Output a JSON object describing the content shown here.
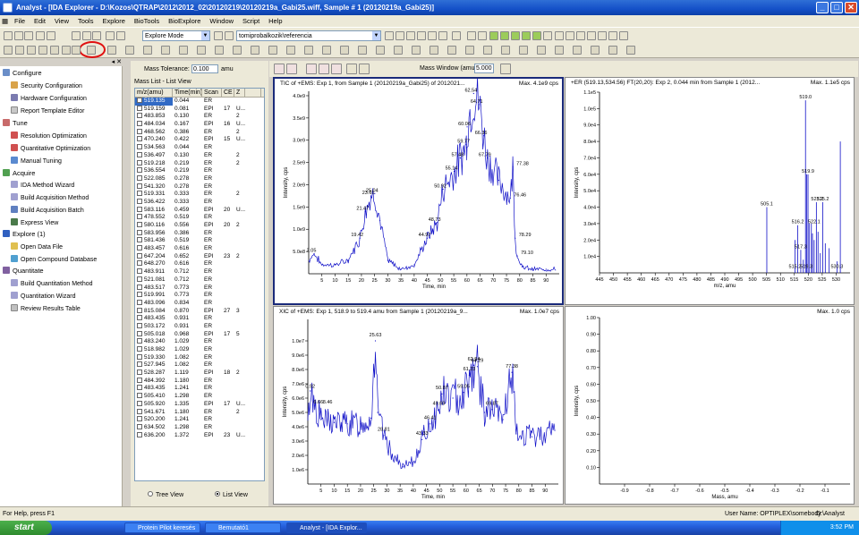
{
  "window": {
    "title": "Analyst - [IDA Explorer - D:\\Kozos\\QTRAP\\2012\\2012_02\\20120219\\20120219a_Gabi25.wiff, Sample # 1 (20120219a_Gabi25)]"
  },
  "menu": [
    "File",
    "Edit",
    "View",
    "Tools",
    "Explore",
    "BioTools",
    "BioExplore",
    "Window",
    "Script",
    "Help"
  ],
  "toolbar": {
    "mode": "Explore Mode",
    "project": "tomiprobalkozik\\referencia"
  },
  "nav": {
    "configure": {
      "label": "Configure",
      "items": [
        "Security Configuration",
        "Hardware Configuration",
        "Report Template Editor"
      ]
    },
    "tune": {
      "label": "Tune",
      "items": [
        "Resolution Optimization",
        "Quantitative Optimization",
        "Manual Tuning"
      ]
    },
    "acquire": {
      "label": "Acquire",
      "items": [
        "IDA Method Wizard",
        "Build Acquisition Method",
        "Build Acquisition Batch",
        "Express View"
      ]
    },
    "explore": {
      "label": "Explore  (1)",
      "items": [
        "Open Data File",
        "Open Compound Database"
      ]
    },
    "quantitate": {
      "label": "Quantitate",
      "items": [
        "Build Quantitation Method",
        "Quantitation Wizard",
        "Review Results Table"
      ]
    }
  },
  "mass": {
    "tolerance_label": "Mass Tolerance:",
    "tolerance": "0.100",
    "unit": "amu",
    "list_title": "Mass List - List View",
    "window_label": "Mass Window (amu):",
    "window": "5.000",
    "headers": [
      "m/z(amu)",
      "Time(min)",
      "Scan",
      "CE",
      "Z",
      ""
    ],
    "rows": [
      [
        "519.135",
        "0.044",
        "ER",
        "",
        "",
        ""
      ],
      [
        "519.159",
        "0.081",
        "EPI",
        "17",
        "U...",
        ""
      ],
      [
        "483.853",
        "0.130",
        "ER",
        "",
        "2",
        ""
      ],
      [
        "484.034",
        "0.167",
        "EPI",
        "16",
        "U...",
        ""
      ],
      [
        "468.562",
        "0.386",
        "ER",
        "",
        "2",
        ""
      ],
      [
        "470.240",
        "0.422",
        "EPI",
        "15",
        "U...",
        ""
      ],
      [
        "534.563",
        "0.044",
        "ER",
        "",
        "",
        ""
      ],
      [
        "536.497",
        "0.130",
        "ER",
        "",
        "2",
        ""
      ],
      [
        "519.218",
        "0.219",
        "ER",
        "",
        "2",
        ""
      ],
      [
        "536.554",
        "0.219",
        "ER",
        "",
        "",
        ""
      ],
      [
        "522.085",
        "0.278",
        "ER",
        "",
        "",
        ""
      ],
      [
        "541.320",
        "0.278",
        "ER",
        "",
        "",
        ""
      ],
      [
        "519.331",
        "0.333",
        "ER",
        "",
        "2",
        ""
      ],
      [
        "536.422",
        "0.333",
        "ER",
        "",
        "",
        ""
      ],
      [
        "583.116",
        "0.459",
        "EPI",
        "20",
        "U...",
        ""
      ],
      [
        "478.552",
        "0.519",
        "ER",
        "",
        "",
        ""
      ],
      [
        "580.116",
        "0.556",
        "EPI",
        "20",
        "2",
        ""
      ],
      [
        "583.956",
        "0.386",
        "ER",
        "",
        "",
        ""
      ],
      [
        "581.436",
        "0.519",
        "ER",
        "",
        "",
        ""
      ],
      [
        "483.457",
        "0.616",
        "ER",
        "",
        "",
        ""
      ],
      [
        "647.204",
        "0.652",
        "EPI",
        "23",
        "2",
        ""
      ],
      [
        "648.270",
        "0.616",
        "ER",
        "",
        "",
        ""
      ],
      [
        "483.911",
        "0.712",
        "ER",
        "",
        "",
        ""
      ],
      [
        "521.081",
        "0.712",
        "ER",
        "",
        "",
        ""
      ],
      [
        "483.517",
        "0.773",
        "ER",
        "",
        "",
        ""
      ],
      [
        "519.991",
        "0.773",
        "ER",
        "",
        "",
        ""
      ],
      [
        "483.096",
        "0.834",
        "ER",
        "",
        "",
        ""
      ],
      [
        "815.084",
        "0.870",
        "EPI",
        "27",
        "3",
        ""
      ],
      [
        "483.435",
        "0.931",
        "ER",
        "",
        "",
        ""
      ],
      [
        "503.172",
        "0.931",
        "ER",
        "",
        "",
        ""
      ],
      [
        "505.018",
        "0.968",
        "EPI",
        "17",
        "5",
        ""
      ],
      [
        "483.240",
        "1.029",
        "ER",
        "",
        "",
        ""
      ],
      [
        "518.982",
        "1.029",
        "ER",
        "",
        "",
        ""
      ],
      [
        "519.330",
        "1.082",
        "ER",
        "",
        "",
        ""
      ],
      [
        "527.945",
        "1.082",
        "ER",
        "",
        "",
        ""
      ],
      [
        "528.287",
        "1.119",
        "EPI",
        "18",
        "2",
        ""
      ],
      [
        "484.392",
        "1.180",
        "ER",
        "",
        "",
        ""
      ],
      [
        "483.435",
        "1.241",
        "ER",
        "",
        "",
        ""
      ],
      [
        "505.410",
        "1.298",
        "ER",
        "",
        "",
        ""
      ],
      [
        "505.920",
        "1.335",
        "EPI",
        "17",
        "U...",
        ""
      ],
      [
        "541.671",
        "1.180",
        "ER",
        "",
        "2",
        ""
      ],
      [
        "520.200",
        "1.241",
        "ER",
        "",
        "",
        ""
      ],
      [
        "634.502",
        "1.298",
        "ER",
        "",
        "",
        ""
      ],
      [
        "636.200",
        "1.372",
        "EPI",
        "23",
        "U...",
        ""
      ]
    ],
    "radio_tree": "Tree View",
    "radio_list": "List View"
  },
  "plots": {
    "tic": {
      "title": "TIC of +EMS: Exp 1, from Sample 1 (20120219a_Gabi25) of 2012021...",
      "max": "Max. 4.1e9 cps",
      "xlabel": "Time, min",
      "ylabel": "Intensity, cps"
    },
    "er": {
      "title": "+ER (519.13,534.56) FT(20,20): Exp 2, 0.044 min from Sample 1 (2012...",
      "max": "Max. 1.1e5 cps",
      "xlabel": "m/z, amu",
      "ylabel": "Intensity, cps"
    },
    "xic": {
      "title": "XIC of +EMS: Exp 1, 518.9 to 519.4 amu from Sample 1 (20120219a_9...",
      "max": "Max. 1.0e7 cps",
      "xlabel": "Time, min",
      "ylabel": "Intensity, cps"
    },
    "empty": {
      "max": "Max. 1.0 cps",
      "xlabel": "Mass, amu",
      "ylabel": "Intensity, cps"
    }
  },
  "chart_data": [
    {
      "type": "line",
      "title": "TIC of +EMS: Exp 1, from Sample 1 (20120219a_Gabi25) of 2012021...",
      "xlabel": "Time, min",
      "ylabel": "Intensity, cps",
      "xlim": [
        0,
        95
      ],
      "ylim": [
        0,
        4100000000.0
      ],
      "x_ticks": [
        5,
        10,
        15,
        20,
        25,
        30,
        35,
        40,
        45,
        50,
        55,
        60,
        65,
        70,
        75,
        80,
        85,
        90
      ],
      "y_ticks": [
        {
          "v": 500000000.0,
          "label": "5.0e8"
        },
        {
          "v": 1000000000.0,
          "label": "1.0e9"
        },
        {
          "v": 1500000000.0,
          "label": "1.5e9"
        },
        {
          "v": 2000000000.0,
          "label": "2.0e9"
        },
        {
          "v": 2500000000.0,
          "label": "2.5e9"
        },
        {
          "v": 3000000000.0,
          "label": "3.0e9"
        },
        {
          "v": 3500000000.0,
          "label": "3.5e9"
        },
        {
          "v": 4000000000.0,
          "label": "4.0e9"
        }
      ],
      "points": [
        [
          0,
          300000000.0
        ],
        [
          2.05,
          450000000.0
        ],
        [
          5,
          200000000.0
        ],
        [
          10,
          200000000.0
        ],
        [
          15,
          300000000.0
        ],
        [
          19.42,
          800000000.0
        ],
        [
          21.47,
          1400000000.0
        ],
        [
          23.61,
          1750000000.0
        ],
        [
          25.04,
          1800000000.0
        ],
        [
          27,
          1200000000.0
        ],
        [
          30,
          300000000.0
        ],
        [
          35,
          100000000.0
        ],
        [
          40,
          200000000.0
        ],
        [
          44.97,
          800000000.0
        ],
        [
          48.73,
          1150000000.0
        ],
        [
          50.92,
          1900000000.0
        ],
        [
          55.14,
          2300000000.0
        ],
        [
          57.48,
          2600000000.0
        ],
        [
          59.77,
          2900000000.0
        ],
        [
          60.06,
          3300000000.0
        ],
        [
          62.54,
          4050000000.0
        ],
        [
          64.71,
          3800000000.0
        ],
        [
          66.36,
          3100000000.0
        ],
        [
          67.79,
          2600000000.0
        ],
        [
          72,
          2100000000.0
        ],
        [
          76.46,
          1700000000.0
        ],
        [
          77.38,
          2400000000.0
        ],
        [
          78.29,
          800000000.0
        ],
        [
          79.1,
          400000000.0
        ],
        [
          81,
          150000000.0
        ],
        [
          85,
          100000000.0
        ],
        [
          90,
          100000000.0
        ],
        [
          94,
          100000000.0
        ]
      ],
      "annotations": [
        "2.05",
        "19.42",
        "21.47",
        "23.61",
        "25.04",
        "44.97",
        "48.73",
        "50.92",
        "55.14",
        "57.48",
        "59.77",
        "60.06",
        "62.54",
        "64.71",
        "66.36",
        "67.79",
        "77.38",
        "76.46",
        "78.29",
        "79.10"
      ]
    },
    {
      "type": "bar",
      "title": "+ER (519.13,534.56) FT(20,20): Exp 2, 0.044 min from Sample 1 (2012...",
      "xlabel": "m/z, amu",
      "ylabel": "Intensity, cps",
      "xlim": [
        445,
        535
      ],
      "ylim": [
        0,
        110000.0
      ],
      "x_ticks": [
        445,
        450,
        455,
        460,
        465,
        470,
        475,
        480,
        485,
        490,
        495,
        500,
        505,
        510,
        515,
        520,
        525,
        530
      ],
      "y_ticks": [
        {
          "v": 10000.0,
          "label": "1.0e4"
        },
        {
          "v": 20000.0,
          "label": "2.0e4"
        },
        {
          "v": 30000.0,
          "label": "3.0e4"
        },
        {
          "v": 40000.0,
          "label": "4.0e4"
        },
        {
          "v": 50000.0,
          "label": "5.0e4"
        },
        {
          "v": 60000.0,
          "label": "6.0e4"
        },
        {
          "v": 70000.0,
          "label": "7.0e4"
        },
        {
          "v": 80000.0,
          "label": "8.0e4"
        },
        {
          "v": 90000.0,
          "label": "9.0e4"
        },
        {
          "v": 100000.0,
          "label": "1.0e5"
        },
        {
          "v": 110000.0,
          "label": "1.1e5"
        }
      ],
      "bars": [
        [
          505.1,
          40000.0
        ],
        [
          515.2,
          20000.0
        ],
        [
          516.2,
          29000.0
        ],
        [
          517.3,
          14000.0
        ],
        [
          518.2,
          8000.0
        ],
        [
          519.0,
          105000.0
        ],
        [
          519.4,
          60000.0
        ],
        [
          519.9,
          60000.0
        ],
        [
          520.3,
          30000.0
        ],
        [
          521.1,
          30000.0
        ],
        [
          521.5,
          24000.0
        ],
        [
          522.1,
          20000.0
        ],
        [
          522.9,
          43000.0
        ],
        [
          523.5,
          25000.0
        ],
        [
          524.3,
          12000.0
        ],
        [
          525.2,
          43000.0
        ],
        [
          526.1,
          18000.0
        ],
        [
          527.5,
          15000.0
        ],
        [
          530.3,
          7000.0
        ],
        [
          531.5,
          80000.0
        ]
      ],
      "annotations": [
        "505.1",
        "519.0",
        "519.9",
        "523.2",
        "525.2",
        "516.2",
        "522.1",
        "517.3",
        "515.2",
        "519.3",
        "530.3"
      ]
    },
    {
      "type": "line",
      "title": "XIC of +EMS: Exp 1, 518.9 to 519.4 amu from Sample 1 (20120219a_9...",
      "xlabel": "Time, min",
      "ylabel": "Intensity, cps",
      "xlim": [
        0,
        95
      ],
      "ylim": [
        0,
        11500000.0
      ],
      "x_ticks": [
        5,
        10,
        15,
        20,
        25,
        30,
        35,
        40,
        45,
        50,
        55,
        60,
        65,
        70,
        75,
        80,
        85,
        90
      ],
      "y_ticks": [
        {
          "v": 1000000.0,
          "label": "1.0e6"
        },
        {
          "v": 2000000.0,
          "label": "2.0e6"
        },
        {
          "v": 3000000.0,
          "label": "3.0e6"
        },
        {
          "v": 4000000.0,
          "label": "4.0e6"
        },
        {
          "v": 5000000.0,
          "label": "5.0e6"
        },
        {
          "v": 6000000.0,
          "label": "6.0e6"
        },
        {
          "v": 7000000.0,
          "label": "7.0e6"
        },
        {
          "v": 8000000.0,
          "label": "8.0e6"
        },
        {
          "v": 9000000.0,
          "label": "9.0e6"
        },
        {
          "v": 10000000.0,
          "label": "1.0e7"
        }
      ],
      "points": [
        [
          0,
          4000000.0
        ],
        [
          0.92,
          6500000.0
        ],
        [
          5,
          4500000.0
        ],
        [
          10,
          4300000.0
        ],
        [
          15,
          4200000.0
        ],
        [
          20,
          4200000.0
        ],
        [
          24,
          4600000.0
        ],
        [
          25.63,
          10000000.0
        ],
        [
          26.5,
          5000000.0
        ],
        [
          28.81,
          3400000.0
        ],
        [
          32,
          2000000.0
        ],
        [
          36,
          1200000.0
        ],
        [
          40,
          1500000.0
        ],
        [
          43.33,
          3100000.0
        ],
        [
          46.41,
          4200000.0
        ],
        [
          49.69,
          5200000.0
        ],
        [
          50.87,
          6300000.0
        ],
        [
          55,
          6000000.0
        ],
        [
          59.05,
          6400000.0
        ],
        [
          61.23,
          7600000.0
        ],
        [
          62.94,
          8300000.0
        ],
        [
          64.29,
          8200000.0
        ],
        [
          67,
          5000000.0
        ],
        [
          69.87,
          5200000.0
        ],
        [
          74,
          4500000.0
        ],
        [
          77.38,
          7800000.0
        ],
        [
          79,
          3500000.0
        ],
        [
          85,
          3300000.0
        ],
        [
          94,
          3800000.0
        ]
      ],
      "annotations": [
        "0.92",
        "6.66",
        "8.46",
        "25.63",
        "28.81",
        "43.33",
        "46.41",
        "49.69",
        "50.87",
        "59.05",
        "61.23",
        "62.94",
        "64.29",
        "69.87",
        "77.38"
      ]
    },
    {
      "type": "line",
      "title": "",
      "xlabel": "Mass, amu",
      "ylabel": "Intensity, cps",
      "xlim": [
        -1,
        0
      ],
      "ylim": [
        0,
        1
      ],
      "x_ticks": [
        {
          "v": -0.9,
          "label": "-0.9"
        },
        {
          "v": -0.8,
          "label": "-0.8"
        },
        {
          "v": -0.7,
          "label": "-0.7"
        },
        {
          "v": -0.6,
          "label": "-0.6"
        },
        {
          "v": -0.5,
          "label": "-0.5"
        },
        {
          "v": -0.4,
          "label": "-0.4"
        },
        {
          "v": -0.3,
          "label": "-0.3"
        },
        {
          "v": -0.2,
          "label": "-0.2"
        },
        {
          "v": -0.1,
          "label": "-0.1"
        }
      ],
      "y_ticks": [
        {
          "v": 0.1,
          "label": "0.10"
        },
        {
          "v": 0.2,
          "label": "0.20"
        },
        {
          "v": 0.3,
          "label": "0.30"
        },
        {
          "v": 0.4,
          "label": "0.40"
        },
        {
          "v": 0.5,
          "label": "0.50"
        },
        {
          "v": 0.6,
          "label": "0.60"
        },
        {
          "v": 0.7,
          "label": "0.70"
        },
        {
          "v": 0.8,
          "label": "0.80"
        },
        {
          "v": 0.9,
          "label": "0.90"
        },
        {
          "v": 1.0,
          "label": "1.00"
        }
      ],
      "points": []
    }
  ],
  "status": {
    "help": "For Help, press F1",
    "user": "User Name: OPTIPLEX\\somebody",
    "path": "D:\\Analyst Data"
  },
  "taskbar": {
    "start": "start",
    "tasks": [
      "Protein Pilot keresés",
      "Bemutató1",
      "Analyst - [IDA Explor..."
    ],
    "time": "3:52 PM"
  }
}
